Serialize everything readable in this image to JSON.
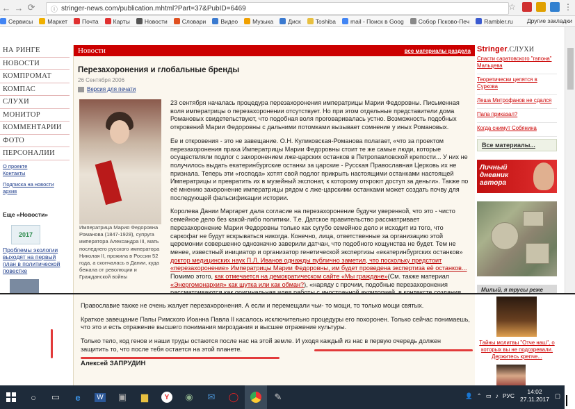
{
  "browser": {
    "url": "stringer-news.com/publication.mhtml?Part=37&PubID=6469",
    "url_host": "stringer-news.com",
    "url_path": "/publication.mhtml?Part=37&PubID=6469"
  },
  "bookmarks": [
    {
      "label": "Сервисы",
      "icon": "apps-icon",
      "color": "#4285f4"
    },
    {
      "label": "Маркет",
      "icon": "market-icon",
      "color": "#f0b000"
    },
    {
      "label": "Почта",
      "icon": "mail-icon",
      "color": "#e03030"
    },
    {
      "label": "Карты",
      "icon": "maps-icon",
      "color": "#e03030"
    },
    {
      "label": "Новости",
      "icon": "news-icon",
      "color": "#555555"
    },
    {
      "label": "Словари",
      "icon": "dictionary-icon",
      "color": "#e05020"
    },
    {
      "label": "Видео",
      "icon": "video-icon",
      "color": "#3a7ad0"
    },
    {
      "label": "Музыка",
      "icon": "music-icon",
      "color": "#f0a000"
    },
    {
      "label": "Диск",
      "icon": "disk-icon",
      "color": "#3a7ad0"
    },
    {
      "label": "Toshiba",
      "icon": "folder-icon",
      "color": "#e8c040"
    },
    {
      "label": "mail - Поиск в Goog",
      "icon": "google-icon",
      "color": "#4285f4"
    },
    {
      "label": "Собор Псково-Печ",
      "icon": "page-icon",
      "color": "#888888"
    },
    {
      "label": "Rambler.ru",
      "icon": "rambler-icon",
      "color": "#3a5ad0"
    }
  ],
  "bookmarks_other": "Другие закладки",
  "left_nav": [
    "НА РИНГЕ",
    "НОВОСТИ",
    "КОМПРОМАТ",
    "КОМПАС",
    "СЛУХИ",
    "МОНИТОР",
    "КОММЕНТАРИИ",
    "ФОТО",
    "ПЕРСОНАЛИИ"
  ],
  "left_links": [
    "О проекте",
    "Контакты"
  ],
  "left_sub_link": [
    "Подписка на новости",
    "архив"
  ],
  "left_promo_title": "Еще «Новости»",
  "left_logo_text": "2017",
  "left_news": "Проблемы экологии выходят на первый план в политической повестке",
  "section": {
    "title": "Новости",
    "all_link": "все материалы раздела"
  },
  "article": {
    "title": "Перезахоронения и глобальные бренды",
    "date": "26 Сентября 2006",
    "print_link": "Версия для печати",
    "caption": "Императрица Мария Федоровна Романова (1847-1928), супруга императора Александра III, мать последнего русского императора Николая II, прожила в России 52 года, а скончалась в Дании, куда бежала от революции и Гражданской войны",
    "p1": "23 сентября началась процедура перезахоронения императрицы Марии Федоровны. Письменная воля императрицы о перезахоронении отсутствует. Но при этом отдельные представители дома Романовых свидетельствуют, что подобная воля проговаривалась устно. Возможность подобных откровений Марии Федоровны с дальними потомками вызывает сомнение у иных Романовых.",
    "p2": "Ее и откровения - это не завещание. О.Н. Куликовская-Романова полагает, «что за проектом перезахоронения праха Императрицы Марии Федоровны стоит те же самые люди, которые осуществляли подлог с захоронением лже-царских останков в Петропавловской крепости... У них не получилось выдать екатеринбургские останки за царские - Русская Православная Церковь их не признала. Теперь эти «господа» хотят свой подлог прикрыть настоящими останками настоящей Императрицы и превратить их в музейный экспонат, к которому откроют доступ за деньги». Также по её мнению захоронение императрицы рядом с лже-царскими останками может создать почву для последующей фальсификации истории.",
    "p3_start": "Королева Дании Маргарет дала согласие на перезахоронение будучи уверенной, что это - чисто семейное дело без какой-либо политики. Т.е. Датское правительство рассматривает перезахоронение Марии Федоровны только как сугубо семейное дело и исходит из того, что саркофаг не будут вскрываться никогда. Конечно, лица, ответственные за организацию этой церемонии совершенно однозначно заверили датчан, что подобного кощунства не будет. Тем не менее, известный инициатор и организатор генетической экспертизы «екатеринбургских останков» ",
    "p3_link1": "доктор медицинских наук П.Л. Иванов однажды публично заметил, что поскольку предстоит «перезахоронение» Императрицы Марии Федоровны, им будет проведена экспертиза её останков...",
    "p3_mid": " Помимо этого, ",
    "p3_link2": "как отмечается на демократическом сайте «Мы граждане»",
    "p3_mid2": "(См. также материал ",
    "p3_link3": "«Энергомонархия» как шутка или как обман?",
    "p3_end": "), «наряду с прочим, подобные перезахоронения рассматриваются как оригинальная идея работы с иностранной аудиторией, в контексте создания глобальных брендов. Сакральный бренд России ...»",
    "p4": "Православие также не очень жалует перезахоронения. А если и перемещали чьи- то мощи, то только мощи святых.",
    "p5": "Краткое завещание Папы Римского Иоанна Павла II касалось исключительно процедуры его похоронен. Только сейчас понимаешь, что это и есть отражение высшего понимания мироздания и высшее отражение культуры.",
    "p6": "Только тело, код генов и наши труды остаются после нас на этой земле. И уходя каждый из нас в первую очередь должен защитить то, что после тебя остается на этой планете.",
    "author": "Алексей ЗАПРУДИН"
  },
  "right_col": {
    "brand_main": "Stringer",
    "brand_suffix": ".СЛУХИ",
    "links": [
      "Спасти саратовского \"гапона\" Мальцева",
      "Теоретически целятся в Суркова",
      "Леша Митрофанов не сдался",
      "Папа приказал?",
      "Когда снимут Собянина"
    ],
    "all_materials": "Все материалы...",
    "diary_label_1": "Личный",
    "diary_label_2": "дневник",
    "diary_label_3": "автора",
    "quote_card": "Милый, я трусы реже",
    "lower_link": "Тайны молитвы \"Отче наш\", о которых вы не подозревали. Держитесь крепче..."
  },
  "taskbar": {
    "lang": "РУС",
    "time": "14:02",
    "date": "27.11.2017"
  }
}
